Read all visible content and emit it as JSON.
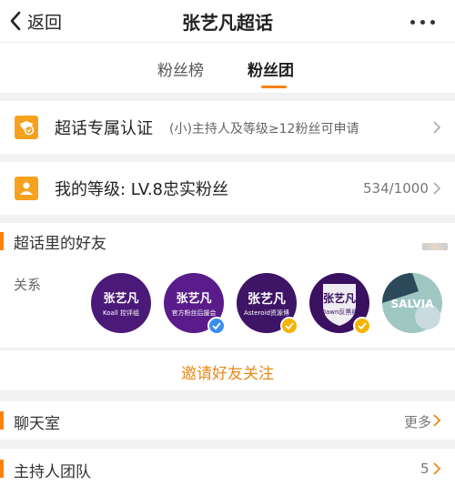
{
  "header": {
    "back_label": "返回",
    "title": "张艺凡超话"
  },
  "tabs": [
    {
      "label": "粉丝榜",
      "active": false
    },
    {
      "label": "粉丝团",
      "active": true
    }
  ],
  "verification": {
    "title": "超话专属认证",
    "description": "(小)主持人及等级≥12粉丝可申请"
  },
  "level": {
    "title": "我的等级: LV.8忠实粉丝",
    "progress": "534/1000"
  },
  "friends_section": {
    "title": "超话里的好友",
    "relation_label": "关系",
    "avatars": [
      {
        "name": "张艺凡",
        "subtitle": "Koall 控评组",
        "verified": false
      },
      {
        "name": "张艺凡",
        "subtitle": "官方粉丝后援会",
        "verified": true
      },
      {
        "name": "张艺凡",
        "subtitle": "Asteroid资源博",
        "verified": true
      },
      {
        "name": "张艺凡",
        "subtitle": "Dawn反黑组",
        "verified": true
      },
      {
        "name": "SALVIA",
        "subtitle": "",
        "verified": false
      }
    ],
    "invite_label": "邀请好友关注"
  },
  "chatroom": {
    "title": "聊天室",
    "more_label": "更多"
  },
  "hosts": {
    "title": "主持人团队",
    "count": "5"
  },
  "colors": {
    "accent": "#ff8200",
    "icon_bg": "#f6a21e",
    "avatar_purple": "#4b1a78",
    "badge": "#f5b400"
  }
}
